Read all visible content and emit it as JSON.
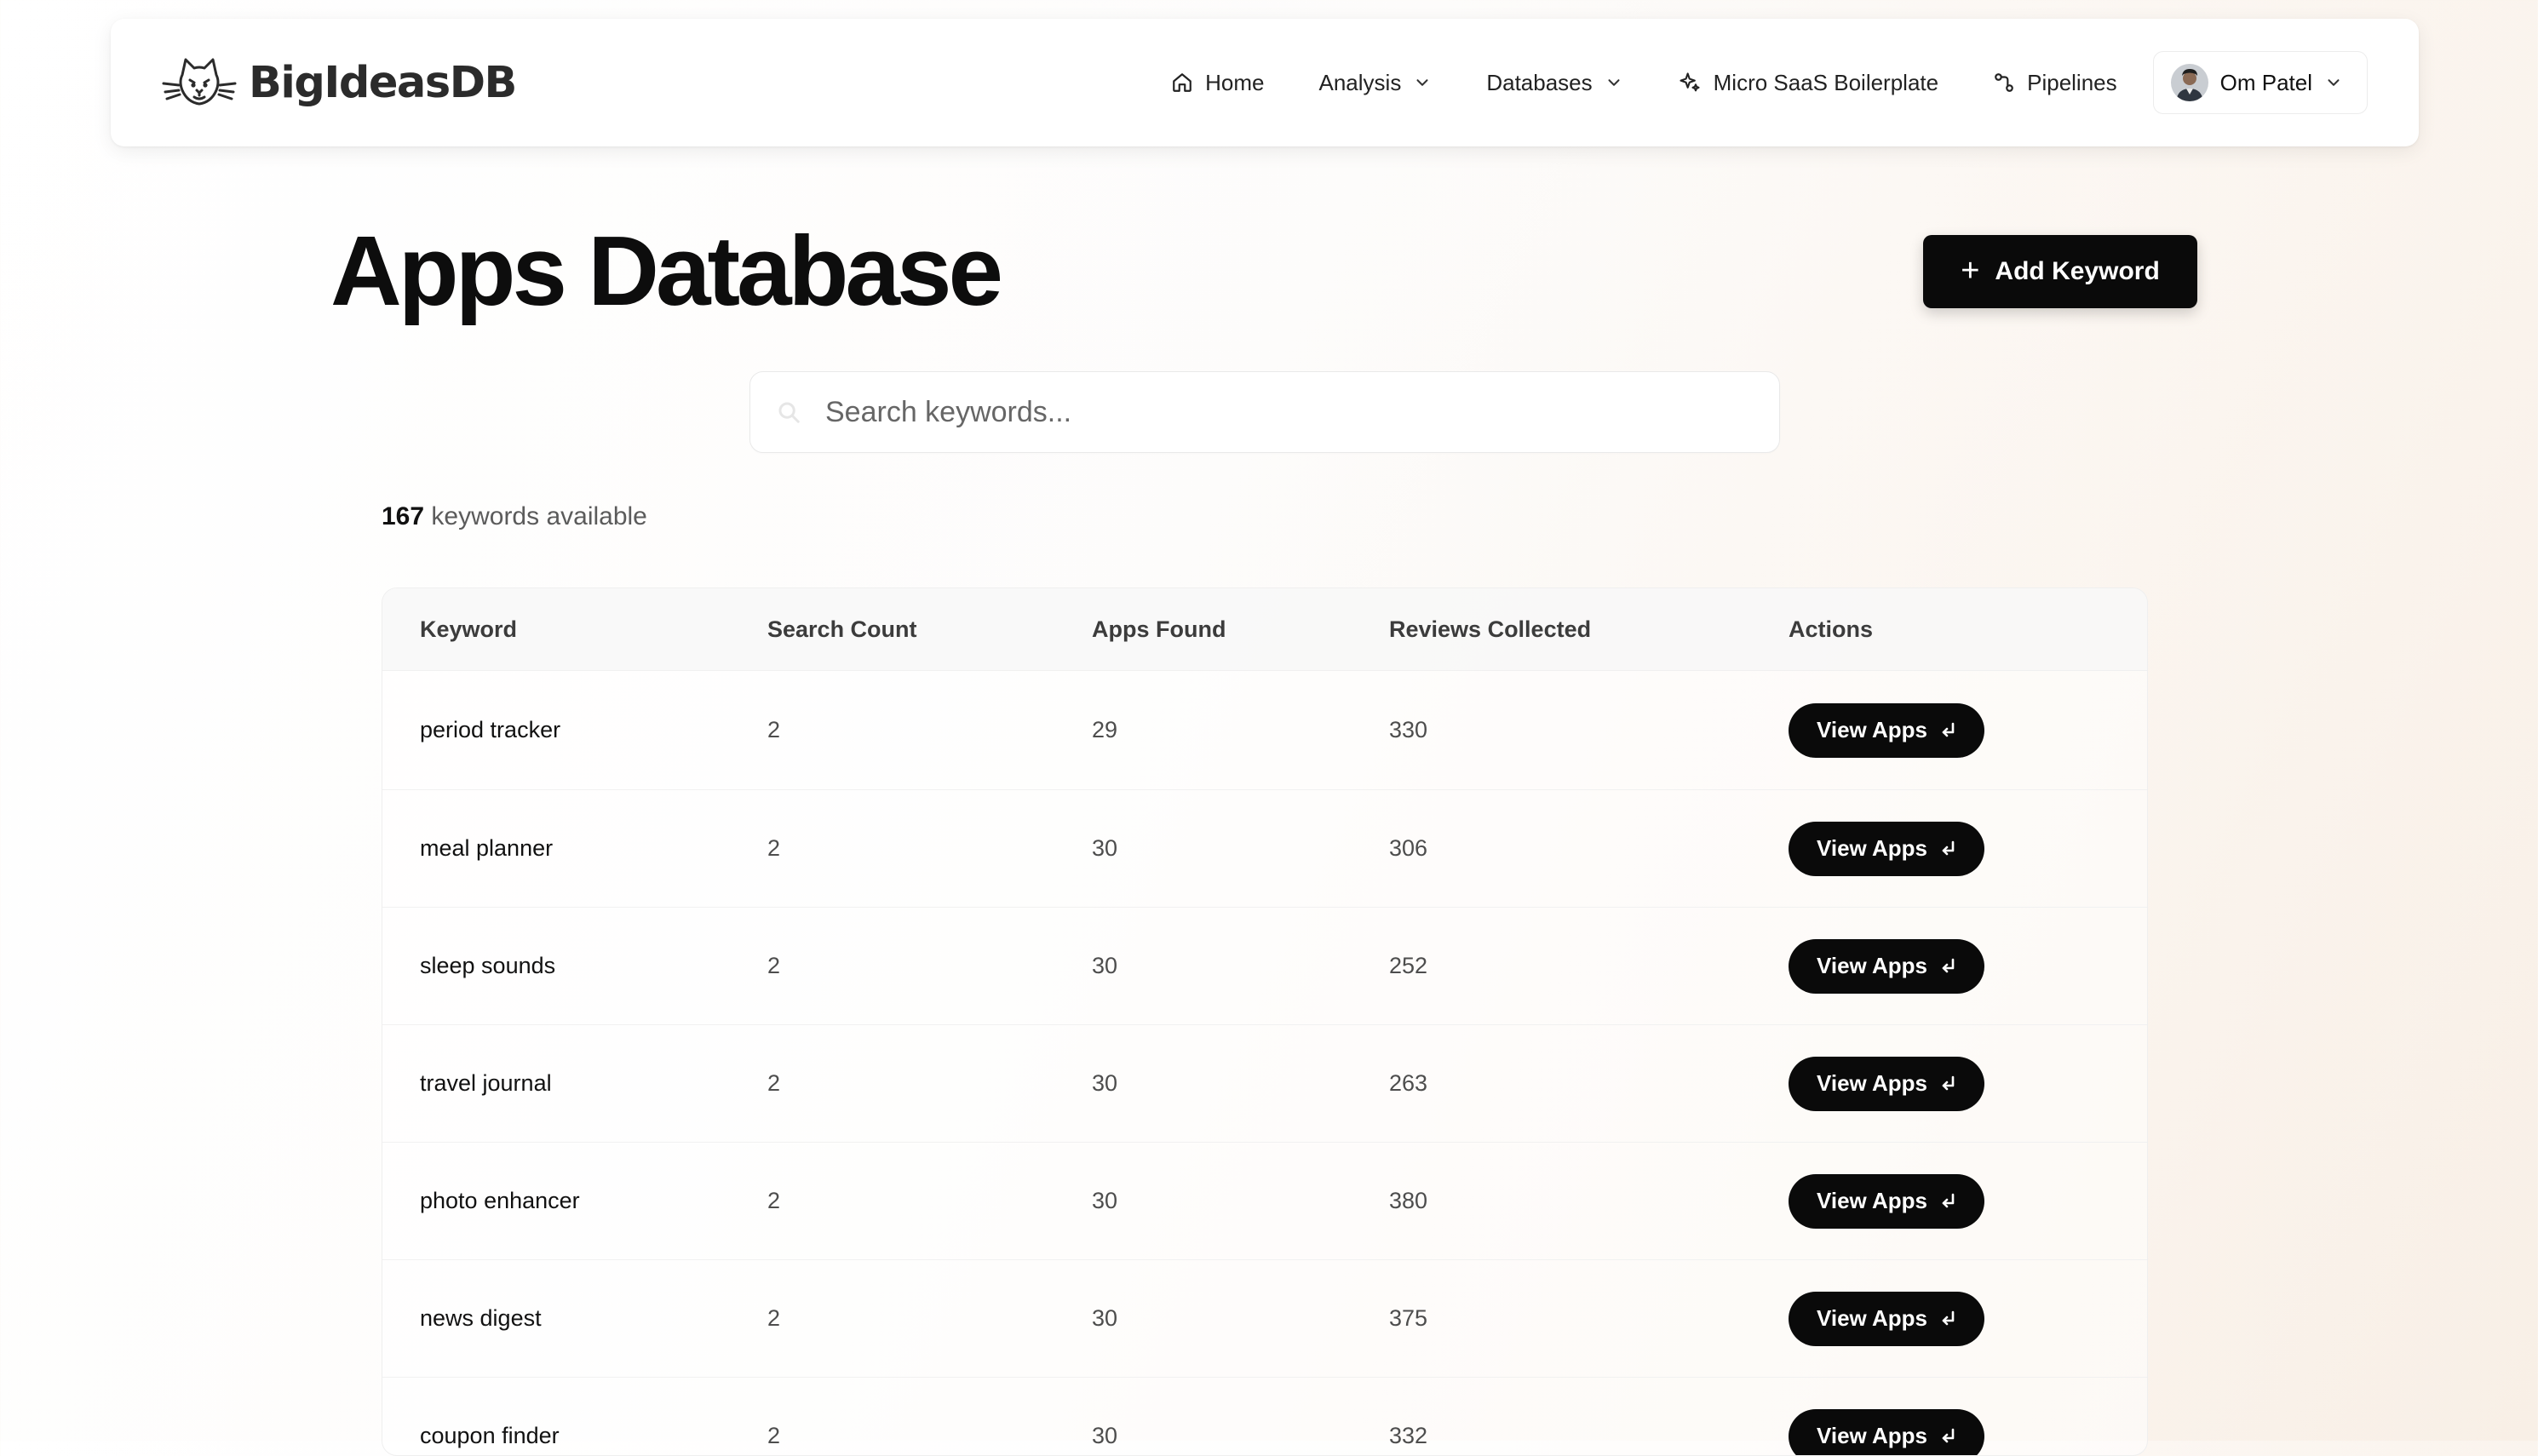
{
  "brand": {
    "name": "BigIdeasDB",
    "logo_icon": "cat-icon"
  },
  "nav": {
    "items": [
      {
        "label": "Home",
        "icon": "home-icon"
      },
      {
        "label": "Analysis",
        "icon": "chevron-down-icon"
      },
      {
        "label": "Databases",
        "icon": "chevron-down-icon"
      },
      {
        "label": "Micro SaaS Boilerplate",
        "icon": "sparkle-icon"
      },
      {
        "label": "Pipelines",
        "icon": "pipeline-icon"
      }
    ],
    "user": {
      "name": "Om Patel",
      "icon": "chevron-down-icon"
    }
  },
  "page": {
    "title": "Apps Database",
    "add_button_label": "Add Keyword"
  },
  "search": {
    "placeholder": "Search keywords...",
    "value": ""
  },
  "summary": {
    "count": "167",
    "count_label": "keywords available"
  },
  "table": {
    "columns": [
      "Keyword",
      "Search Count",
      "Apps Found",
      "Reviews Collected",
      "Actions"
    ],
    "action_label": "View Apps",
    "rows": [
      {
        "keyword": "period tracker",
        "search_count": "2",
        "apps_found": "29",
        "reviews_collected": "330"
      },
      {
        "keyword": "meal planner",
        "search_count": "2",
        "apps_found": "30",
        "reviews_collected": "306"
      },
      {
        "keyword": "sleep sounds",
        "search_count": "2",
        "apps_found": "30",
        "reviews_collected": "252"
      },
      {
        "keyword": "travel journal",
        "search_count": "2",
        "apps_found": "30",
        "reviews_collected": "263"
      },
      {
        "keyword": "photo enhancer",
        "search_count": "2",
        "apps_found": "30",
        "reviews_collected": "380"
      },
      {
        "keyword": "news digest",
        "search_count": "2",
        "apps_found": "30",
        "reviews_collected": "375"
      },
      {
        "keyword": "coupon finder",
        "search_count": "2",
        "apps_found": "30",
        "reviews_collected": "332"
      }
    ]
  },
  "colors": {
    "button_bg": "#0a0a0a",
    "button_text": "#ffffff",
    "page_bg_warm": "#f8efe6"
  }
}
